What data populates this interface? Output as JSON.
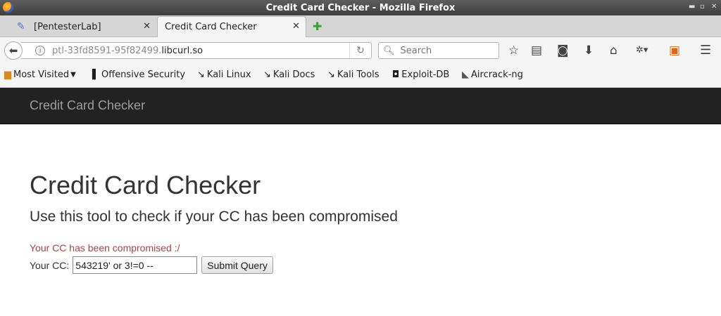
{
  "window": {
    "title": "Credit Card Checker - Mozilla Firefox",
    "controls": {
      "minimize": "▫",
      "maximize": "▫",
      "close": "✕"
    }
  },
  "tabs": [
    {
      "label": "[PentesterLab]",
      "active": false,
      "icon": "tag-icon"
    },
    {
      "label": "Credit Card Checker",
      "active": true
    }
  ],
  "tab_close_glyph": "✕",
  "new_tab_glyph": "✚",
  "navbar": {
    "url_prefix": "ptl-33fd8591-95f82499.",
    "url_host": "libcurl.so",
    "search_placeholder": "Search"
  },
  "bookmarks": [
    {
      "label": "Most Visited",
      "icon": "folder-icon",
      "has_dropdown": true
    },
    {
      "label": "Offensive Security",
      "icon": "offsec-icon"
    },
    {
      "label": "Kali Linux",
      "icon": "kali-dragon-icon"
    },
    {
      "label": "Kali Docs",
      "icon": "kali-dragon-icon"
    },
    {
      "label": "Kali Tools",
      "icon": "kali-dragon-icon"
    },
    {
      "label": "Exploit-DB",
      "icon": "exploitdb-icon"
    },
    {
      "label": "Aircrack-ng",
      "icon": "aircrack-icon"
    }
  ],
  "page": {
    "brand": "Credit Card Checker",
    "heading": "Credit Card Checker",
    "lead": "Use this tool to check if your CC has been compromised",
    "alert": "Your CC has been compromised :/",
    "form": {
      "label": "Your CC:",
      "value": "543219' or 3!=0 --",
      "submit_label": "Submit Query"
    }
  },
  "colors": {
    "page_navbar_bg": "#222222",
    "brand_text": "#9d9d9d",
    "alert_text": "#a94442"
  }
}
